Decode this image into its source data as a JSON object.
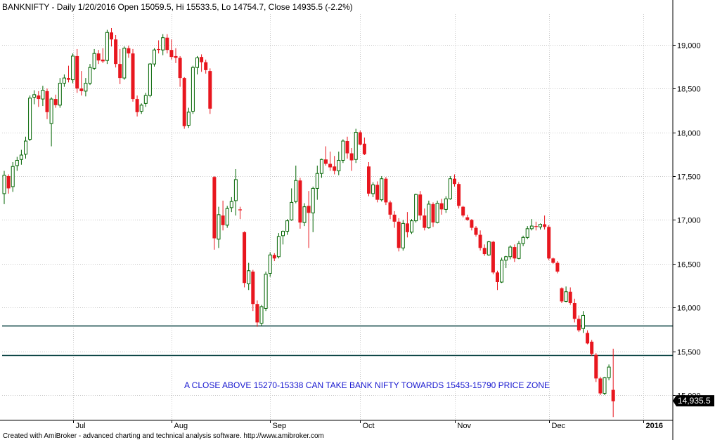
{
  "chart_data": {
    "type": "candlestick",
    "symbol": "BANKNIFTY",
    "title": "BANKNIFTY - Daily 1/20/2016 Open 15059.5, Hi 15533.5, Lo 14754.7, Close 14935.5 (-2.2%)",
    "ylim": [
      14720,
      19350
    ],
    "y_ticks": [
      {
        "value": 15000,
        "label": "15,000"
      },
      {
        "value": 15500,
        "label": "15,500"
      },
      {
        "value": 16000,
        "label": "16,000"
      },
      {
        "value": 16500,
        "label": "16,500"
      },
      {
        "value": 17000,
        "label": "17,000"
      },
      {
        "value": 17500,
        "label": "17,500"
      },
      {
        "value": 18000,
        "label": "18,000"
      },
      {
        "value": 18500,
        "label": "18,500"
      },
      {
        "value": 19000,
        "label": "19,000"
      }
    ],
    "month_labels": [
      {
        "label": "Jul",
        "index": 16,
        "year": false
      },
      {
        "label": "Aug",
        "index": 39,
        "year": false
      },
      {
        "label": "Sep",
        "index": 62,
        "year": false
      },
      {
        "label": "Oct",
        "index": 83,
        "year": false
      },
      {
        "label": "Nov",
        "index": 105,
        "year": false
      },
      {
        "label": "Dec",
        "index": 127,
        "year": false
      },
      {
        "label": "2016",
        "index": 149,
        "year": true
      }
    ],
    "last_close_label": "14,935.5",
    "last_close": 14935.5,
    "horizontal_lines": [
      15790,
      15453
    ],
    "annotation": "A CLOSE ABOVE 15270-15338 CAN TAKE BANK NIFTY  TOWARDS 15453-15790 PRICE ZONE",
    "colors": {
      "up": "#ffffff",
      "up_border": "#006400",
      "down": "#e8161e",
      "line": "#003b3b",
      "tag": "#000000"
    },
    "candles": [
      [
        17300,
        17560,
        17180,
        17510
      ],
      [
        17500,
        17520,
        17300,
        17360
      ],
      [
        17380,
        17660,
        17320,
        17610
      ],
      [
        17620,
        17720,
        17560,
        17680
      ],
      [
        17690,
        17800,
        17630,
        17740
      ],
      [
        17750,
        17950,
        17700,
        17900
      ],
      [
        17920,
        18420,
        17900,
        18390
      ],
      [
        18400,
        18480,
        18320,
        18430
      ],
      [
        18420,
        18470,
        18290,
        18380
      ],
      [
        18380,
        18530,
        18300,
        18480
      ],
      [
        18470,
        18500,
        18150,
        18230
      ],
      [
        18100,
        18400,
        17840,
        18380
      ],
      [
        18380,
        18430,
        18280,
        18310
      ],
      [
        18310,
        18620,
        18280,
        18560
      ],
      [
        18560,
        18660,
        18520,
        18620
      ],
      [
        18620,
        18760,
        18570,
        18600
      ],
      [
        18600,
        18900,
        18560,
        18870
      ],
      [
        18870,
        18950,
        18450,
        18500
      ],
      [
        18500,
        18700,
        18420,
        18470
      ],
      [
        18470,
        18620,
        18410,
        18560
      ],
      [
        18560,
        18780,
        18540,
        18740
      ],
      [
        18730,
        18950,
        18710,
        18900
      ],
      [
        18900,
        18940,
        18780,
        18820
      ],
      [
        18830,
        18960,
        18790,
        18810
      ],
      [
        18820,
        19170,
        18780,
        19140
      ],
      [
        19140,
        19190,
        18980,
        19060
      ],
      [
        19060,
        19110,
        18740,
        18780
      ],
      [
        18780,
        18950,
        18550,
        18620
      ],
      [
        18620,
        18980,
        18600,
        18960
      ],
      [
        18960,
        18990,
        18850,
        18900
      ],
      [
        18900,
        18950,
        18350,
        18380
      ],
      [
        18380,
        18420,
        18180,
        18230
      ],
      [
        18240,
        18330,
        18210,
        18310
      ],
      [
        18330,
        18450,
        18290,
        18420
      ],
      [
        18420,
        18790,
        18400,
        18780
      ],
      [
        18780,
        18960,
        18750,
        18940
      ],
      [
        18950,
        19050,
        18900,
        18940
      ],
      [
        18940,
        19120,
        18880,
        19080
      ],
      [
        19080,
        19120,
        18900,
        18940
      ],
      [
        18940,
        19060,
        18830,
        18860
      ],
      [
        18870,
        18960,
        18790,
        18850
      ],
      [
        18850,
        18870,
        18520,
        18620
      ],
      [
        18620,
        18630,
        18040,
        18070
      ],
      [
        18080,
        18280,
        18050,
        18230
      ],
      [
        18240,
        18760,
        18210,
        18740
      ],
      [
        18740,
        18870,
        18660,
        18850
      ],
      [
        18860,
        18890,
        18690,
        18800
      ],
      [
        18800,
        18830,
        18670,
        18710
      ],
      [
        18700,
        18730,
        18210,
        18270
      ],
      [
        17490,
        17500,
        16660,
        16790
      ],
      [
        16780,
        17150,
        16680,
        17060
      ],
      [
        17050,
        17220,
        16880,
        16940
      ],
      [
        16940,
        17160,
        16910,
        17130
      ],
      [
        17140,
        17260,
        17090,
        17210
      ],
      [
        17220,
        17580,
        17050,
        17460
      ],
      [
        17120,
        17150,
        17010,
        17110
      ],
      [
        16860,
        16870,
        16230,
        16280
      ],
      [
        16270,
        16510,
        16200,
        16420
      ],
      [
        16410,
        16430,
        15960,
        16040
      ],
      [
        16040,
        16080,
        15780,
        15830
      ],
      [
        15820,
        16030,
        15790,
        16010
      ],
      [
        15990,
        16410,
        15960,
        16380
      ],
      [
        16390,
        16630,
        16350,
        16600
      ],
      [
        16600,
        16620,
        16530,
        16560
      ],
      [
        16580,
        16850,
        16560,
        16810
      ],
      [
        16820,
        16880,
        16720,
        16870
      ],
      [
        16870,
        17010,
        16830,
        16990
      ],
      [
        17000,
        17360,
        16990,
        17200
      ],
      [
        17210,
        17620,
        17190,
        17450
      ],
      [
        17450,
        17480,
        16900,
        16970
      ],
      [
        16970,
        17190,
        16930,
        17150
      ],
      [
        17160,
        17330,
        16680,
        17080
      ],
      [
        17080,
        17380,
        16860,
        17360
      ],
      [
        17360,
        17620,
        17230,
        17530
      ],
      [
        17530,
        17700,
        17480,
        17690
      ],
      [
        17690,
        17840,
        17620,
        17640
      ],
      [
        17640,
        17780,
        17560,
        17600
      ],
      [
        17610,
        17730,
        17520,
        17560
      ],
      [
        17560,
        17780,
        17510,
        17680
      ],
      [
        17680,
        17920,
        17650,
        17900
      ],
      [
        17900,
        17950,
        17700,
        17760
      ],
      [
        17760,
        17820,
        17560,
        17680
      ],
      [
        17690,
        18040,
        17650,
        18000
      ],
      [
        18000,
        18020,
        17850,
        17860
      ],
      [
        17870,
        17940,
        17740,
        17750
      ],
      [
        17610,
        17660,
        17270,
        17300
      ],
      [
        17300,
        17430,
        17260,
        17400
      ],
      [
        17400,
        17440,
        17200,
        17230
      ],
      [
        17230,
        17500,
        17210,
        17470
      ],
      [
        17470,
        17490,
        17170,
        17200
      ],
      [
        17200,
        17220,
        17010,
        17060
      ],
      [
        17060,
        17100,
        16910,
        16980
      ],
      [
        16980,
        17020,
        16640,
        16680
      ],
      [
        16680,
        17000,
        16650,
        16960
      ],
      [
        16960,
        17090,
        16800,
        16860
      ],
      [
        16860,
        17010,
        16840,
        16990
      ],
      [
        16990,
        17300,
        16970,
        17290
      ],
      [
        17290,
        17330,
        17000,
        17050
      ],
      [
        17050,
        17130,
        16880,
        16910
      ],
      [
        16910,
        17220,
        16900,
        17180
      ],
      [
        17180,
        17200,
        16920,
        16970
      ],
      [
        16970,
        17220,
        16960,
        17190
      ],
      [
        17190,
        17240,
        17060,
        17120
      ],
      [
        17120,
        17270,
        17080,
        17240
      ],
      [
        17240,
        17500,
        17230,
        17470
      ],
      [
        17470,
        17520,
        17380,
        17410
      ],
      [
        17410,
        17430,
        17130,
        17160
      ],
      [
        17150,
        17160,
        17030,
        17050
      ],
      [
        17030,
        17060,
        16990,
        17000
      ],
      [
        17000,
        17010,
        16880,
        16910
      ],
      [
        16910,
        16930,
        16810,
        16830
      ],
      [
        16830,
        16880,
        16650,
        16680
      ],
      [
        16680,
        16720,
        16590,
        16610
      ],
      [
        16600,
        16760,
        16590,
        16750
      ],
      [
        16750,
        16760,
        16380,
        16400
      ],
      [
        16400,
        16420,
        16200,
        16290
      ],
      [
        16290,
        16570,
        16280,
        16540
      ],
      [
        16540,
        16590,
        16450,
        16580
      ],
      [
        16580,
        16710,
        16550,
        16690
      ],
      [
        16690,
        16720,
        16520,
        16560
      ],
      [
        16560,
        16760,
        16550,
        16730
      ],
      [
        16730,
        16820,
        16700,
        16800
      ],
      [
        16800,
        16930,
        16780,
        16900
      ],
      [
        16900,
        17010,
        16880,
        16930
      ],
      [
        16930,
        16980,
        16880,
        16920
      ],
      [
        16920,
        16960,
        16890,
        16950
      ],
      [
        16950,
        17050,
        16890,
        16920
      ],
      [
        16920,
        16940,
        16540,
        16560
      ],
      [
        16560,
        16570,
        16500,
        16510
      ],
      [
        16510,
        16530,
        16390,
        16410
      ],
      [
        16220,
        16230,
        16050,
        16070
      ],
      [
        16070,
        16240,
        16060,
        16180
      ],
      [
        16180,
        16230,
        16030,
        16050
      ],
      [
        16050,
        16100,
        15830,
        15870
      ],
      [
        15870,
        15910,
        15720,
        15740
      ],
      [
        15760,
        15960,
        15710,
        15910
      ],
      [
        15710,
        15740,
        15580,
        15590
      ],
      [
        15610,
        15630,
        15450,
        15470
      ],
      [
        15460,
        15480,
        15150,
        15190
      ],
      [
        15190,
        15210,
        15000,
        15020
      ],
      [
        15020,
        15210,
        15000,
        15200
      ],
      [
        15200,
        15350,
        15170,
        15320
      ],
      [
        15060,
        15530,
        14750,
        14930
      ]
    ]
  },
  "footer_text": "Created with AmiBroker - advanced charting and technical analysis software. http://www.amibroker.com"
}
